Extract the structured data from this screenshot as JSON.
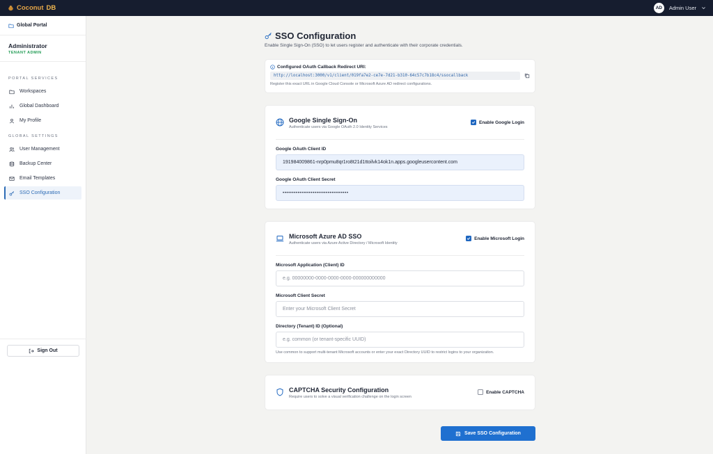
{
  "topbar": {
    "brand_name": "Coconut",
    "brand_suffix": "DB",
    "avatar_initials": "AD",
    "user_name": "Admin User"
  },
  "sidebar": {
    "portal_link": "Global Portal",
    "role_title": "Administrator",
    "role_subtitle": "TENANT ADMIN",
    "section_services": "PORTAL SERVICES",
    "section_settings": "GLOBAL SETTINGS",
    "services": [
      {
        "label": "Workspaces",
        "icon": "folder-icon"
      },
      {
        "label": "Global Dashboard",
        "icon": "bar-chart-icon"
      },
      {
        "label": "My Profile",
        "icon": "user-icon"
      }
    ],
    "settings": [
      {
        "label": "User Management",
        "icon": "users-icon"
      },
      {
        "label": "Backup Center",
        "icon": "database-icon"
      },
      {
        "label": "Email Templates",
        "icon": "mail-icon"
      },
      {
        "label": "SSO Configuration",
        "icon": "key-icon",
        "active": true
      }
    ],
    "signout_label": "Sign Out"
  },
  "page": {
    "title": "SSO Configuration",
    "description": "Enable Single Sign-On (SSO) to let users register and authenticate with their corporate credentials."
  },
  "callback": {
    "label": "Configured OAuth Callback Redirect URI:",
    "url": "http://localhost:3000/v1/client/019fa7e2-ce7e-7d21-b310-64c57c7b18c4/ssocallback",
    "help": "Register this exact URL in Google Cloud Console or Microsoft Azure AD redirect configurations."
  },
  "google": {
    "title": "Google Single Sign-On",
    "subtitle": "Authenticate users via Google OAuth 2.0 Identity Services",
    "toggle_label": "Enable Google Login",
    "enabled": true,
    "client_id_label": "Google OAuth Client ID",
    "client_id_value": "191984009861-nrp0pmu8qr1ro8t21d1ttoilvk14ok1n.apps.googleusercontent.com",
    "client_secret_label": "Google OAuth Client Secret",
    "client_secret_value": "•••••••••••••••••••••••••••••••••••"
  },
  "azure": {
    "title": "Microsoft Azure AD SSO",
    "subtitle": "Authenticate users via Azure Active Directory / Microsoft Identity",
    "toggle_label": "Enable Microsoft Login",
    "enabled": true,
    "app_id_label": "Microsoft Application (Client) ID",
    "app_id_placeholder": "e.g. 00000000-0000-0000-0000-000000000000",
    "secret_label": "Microsoft Client Secret",
    "secret_placeholder": "Enter your Microsoft Client Secret",
    "tenant_label": "Directory (Tenant) ID (Optional)",
    "tenant_placeholder": "e.g. common (or tenant-specific UUID)",
    "tenant_help": "Use common to support multi-tenant Microsoft accounts or enter your exact Directory UUID to restrict logins to your organization."
  },
  "captcha": {
    "title": "CAPTCHA Security Configuration",
    "subtitle": "Require users to solve a visual verification challenge on the login screen",
    "toggle_label": "Enable CAPTCHA",
    "enabled": false
  },
  "save_label": "Save SSO Configuration",
  "colors": {
    "topbar": "#161d2f",
    "accent": "#1f70d0",
    "brand": "#e5a547",
    "tenant_badge": "#1f9a52"
  }
}
